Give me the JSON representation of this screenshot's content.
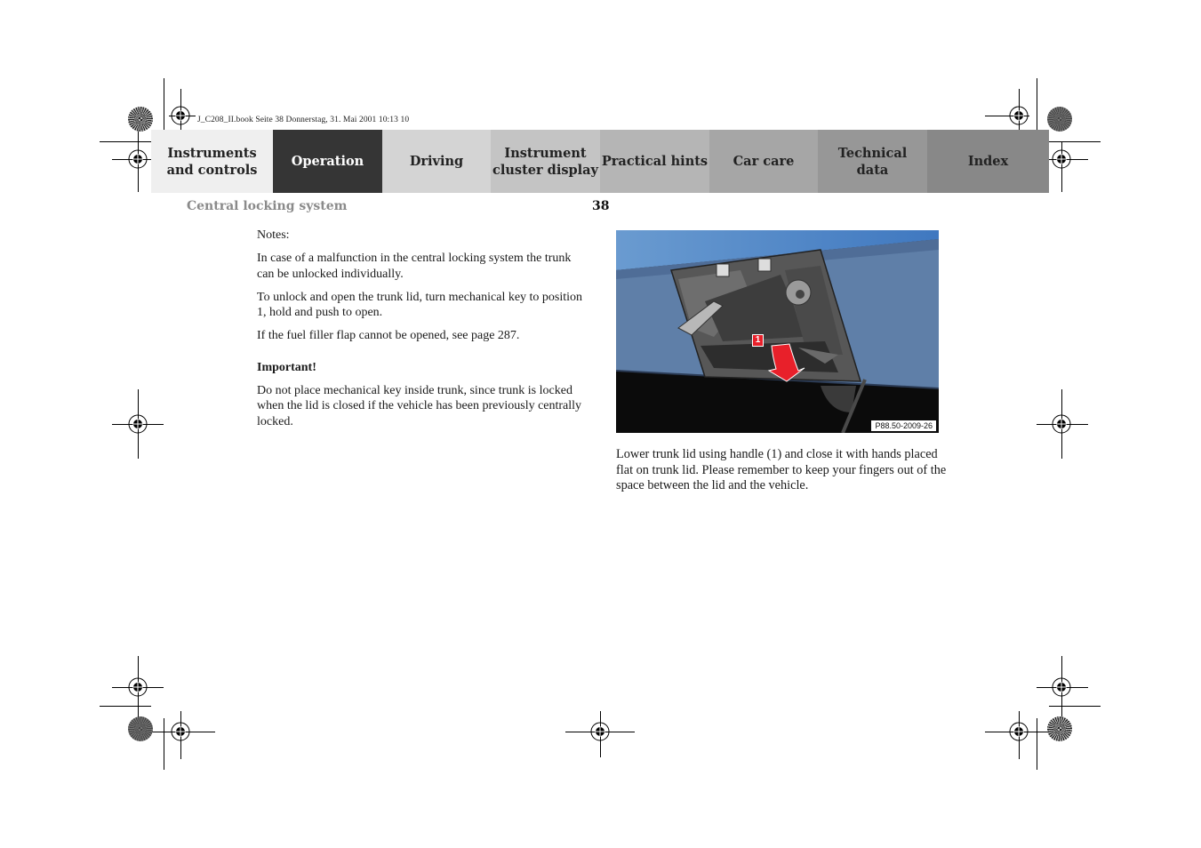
{
  "print_meta": "J_C208_II.book  Seite 38  Donnerstag, 31. Mai 2001  10:13 10",
  "tabs": [
    {
      "label": "Instruments and controls",
      "line1": "Instruments",
      "line2": "and controls",
      "bg": "#efefef",
      "fg": "#222222",
      "active": false
    },
    {
      "label": "Operation",
      "line1": "Operation",
      "line2": "",
      "bg": "#353535",
      "fg": "#ffffff",
      "active": true
    },
    {
      "label": "Driving",
      "line1": "Driving",
      "line2": "",
      "bg": "#d4d4d4",
      "fg": "#222222",
      "active": false
    },
    {
      "label": "Instrument cluster display",
      "line1": "Instrument",
      "line2": "cluster display",
      "bg": "#c4c4c4",
      "fg": "#222222",
      "active": false
    },
    {
      "label": "Practical hints",
      "line1": "Practical hints",
      "line2": "",
      "bg": "#b5b5b5",
      "fg": "#222222",
      "active": false
    },
    {
      "label": "Car care",
      "line1": "Car care",
      "line2": "",
      "bg": "#a6a6a6",
      "fg": "#222222",
      "active": false
    },
    {
      "label": "Technical data",
      "line1": "Technical",
      "line2": "data",
      "bg": "#979797",
      "fg": "#222222",
      "active": false
    },
    {
      "label": "Index",
      "line1": "Index",
      "line2": "",
      "bg": "#888888",
      "fg": "#222222",
      "active": false
    }
  ],
  "section_title": "Central locking system",
  "page_number": "38",
  "left_column": {
    "notes_heading": "Notes:",
    "paragraphs": [
      "In case of a malfunction in the central locking system the trunk can be unlocked individually.",
      "To unlock and open the trunk lid, turn mechanical key to position 1, hold and push to open.",
      "If the fuel filler flap cannot be opened, see page 287."
    ],
    "important_heading": "Important!",
    "important_text": "Do not place mechanical key inside trunk, since trunk is locked when the lid is closed if the vehicle has been previously centrally locked."
  },
  "figure": {
    "callout_label": "1",
    "code": "P88.50-2009-26",
    "colors": {
      "body_blue": "#5c7fae",
      "arrow_red": "#e8202a",
      "handle_gray": "#4a4a4a"
    }
  },
  "right_column": {
    "text": "Lower trunk lid using handle (1) and close it with hands placed flat on trunk lid. Please remember to keep your fingers out of the space between the lid and the vehicle."
  }
}
